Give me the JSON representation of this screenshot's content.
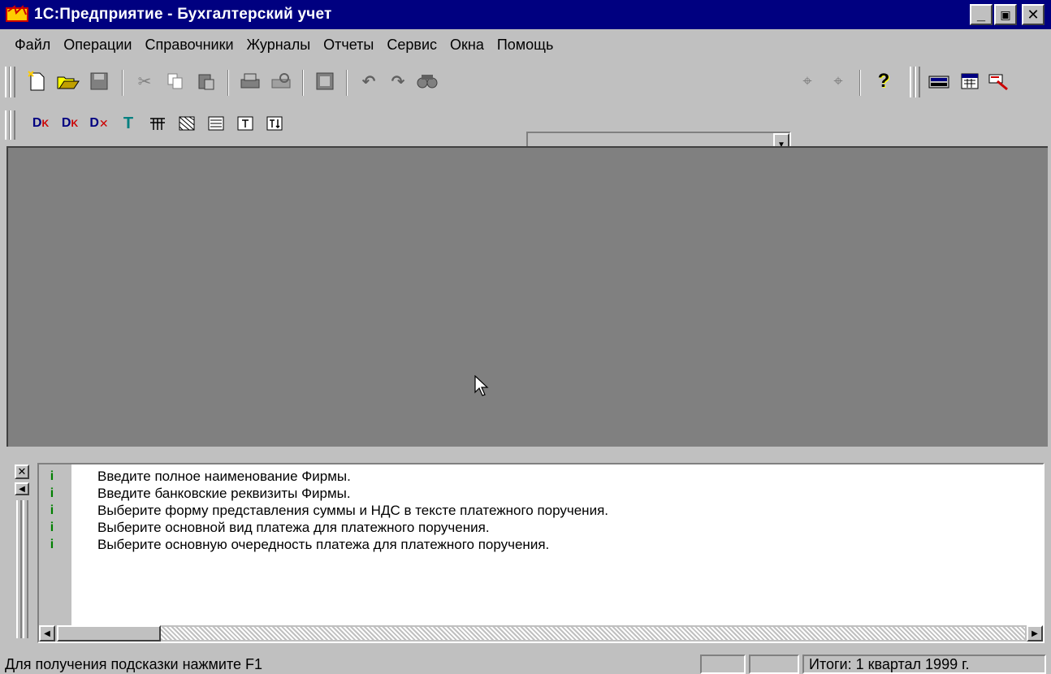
{
  "window": {
    "title": "1С:Предприятие - Бухгалтерский учет",
    "buttons": {
      "minimize": "_",
      "maximize": "▣",
      "close": "✕"
    }
  },
  "menu": {
    "items": [
      "Файл",
      "Операции",
      "Справочники",
      "Журналы",
      "Отчеты",
      "Сервис",
      "Окна",
      "Помощь"
    ]
  },
  "toolbar1": {
    "icons": [
      "new-document-icon",
      "open-folder-icon",
      "save-icon",
      "cut-icon",
      "copy-icon",
      "paste-icon",
      "print-icon",
      "print-preview-icon",
      "properties-icon",
      "undo-icon",
      "redo-icon",
      "find-icon",
      "find-next-icon",
      "find-previous-icon",
      "help-icon",
      "calculator-icon",
      "calendar-icon",
      "quick-search-icon"
    ],
    "search_value": ""
  },
  "toolbar2": {
    "icons": [
      "transaction-journal-icon",
      "transactions-icon",
      "delete-transactions-icon",
      "filter-icon",
      "table-icon",
      "pattern-icon",
      "form-icon",
      "text-field-icon",
      "text-field-insert-icon"
    ]
  },
  "messages": {
    "items": [
      "Введите полное наименование Фирмы.",
      "Введите банковские реквизиты Фирмы.",
      "Выберите форму представления суммы и НДС в тексте платежного поручения.",
      "Выберите основной вид платежа для платежного поручения.",
      "Выберите основную очередность платежа для платежного поручения."
    ],
    "icon": "info-icon",
    "icon_color": "#008000"
  },
  "statusbar": {
    "hint": "Для получения подсказки нажмите F1",
    "period": "Итоги: 1 квартал 1999 г."
  },
  "colors": {
    "titlebar": "#000080",
    "chrome": "#c0c0c0",
    "workspace": "#808080"
  }
}
